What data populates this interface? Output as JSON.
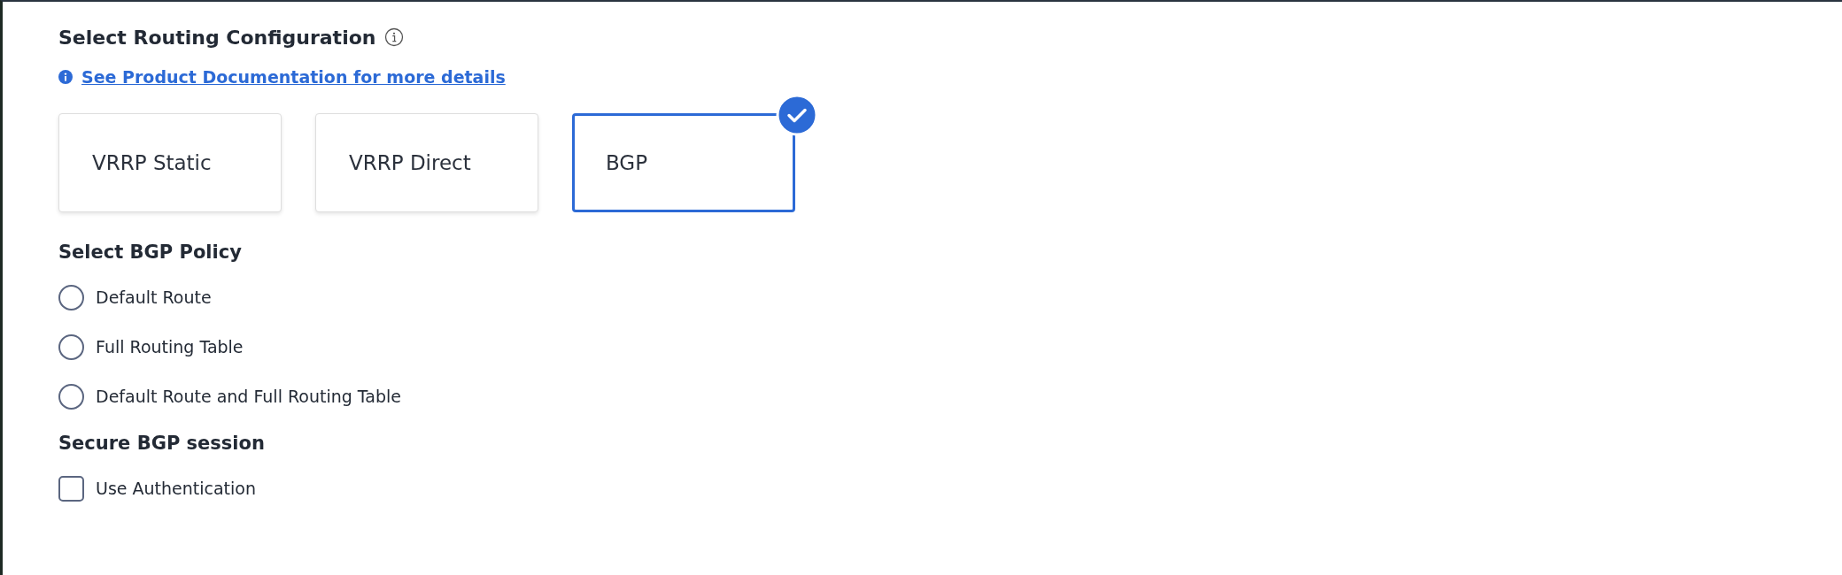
{
  "routing": {
    "title": "Select Routing Configuration",
    "link": "See Product Documentation for more details",
    "options": [
      {
        "label": "VRRP Static",
        "selected": false
      },
      {
        "label": "VRRP Direct",
        "selected": false
      },
      {
        "label": "BGP",
        "selected": true
      }
    ]
  },
  "policy": {
    "title": "Select BGP Policy",
    "options": [
      {
        "label": "Default Route",
        "selected": false
      },
      {
        "label": "Full Routing Table",
        "selected": false
      },
      {
        "label": "Default Route and Full Routing Table",
        "selected": false
      }
    ]
  },
  "security": {
    "title": "Secure BGP session",
    "checkboxes": [
      {
        "label": "Use Authentication",
        "checked": false
      }
    ]
  }
}
